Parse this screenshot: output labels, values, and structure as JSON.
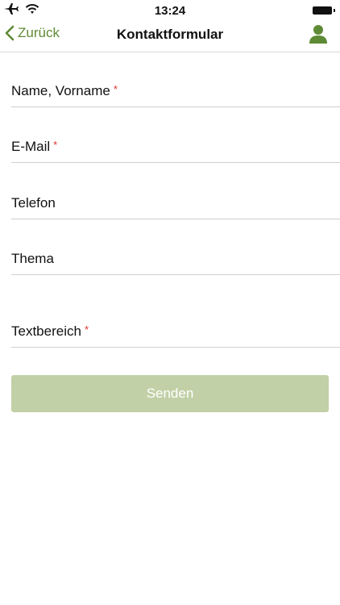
{
  "status_bar": {
    "time": "13:24",
    "icons": [
      "airplane-icon",
      "wifi-icon",
      "battery-icon"
    ]
  },
  "nav": {
    "back_label": "Zurück",
    "title": "Kontaktformular",
    "right_icon": "user-profile-icon"
  },
  "form": {
    "fields": [
      {
        "label": "Name, Vorname",
        "required_mark": "*"
      },
      {
        "label": "E-Mail",
        "required_mark": "*"
      },
      {
        "label": "Telefon",
        "required_mark": ""
      },
      {
        "label": "Thema",
        "required_mark": ""
      },
      {
        "label": "Textbereich",
        "required_mark": "*"
      }
    ],
    "submit_label": "Senden"
  },
  "colors": {
    "accent": "#5f8a35",
    "required": "#e0322b",
    "submit_button_bg": "#c1d0a6"
  }
}
